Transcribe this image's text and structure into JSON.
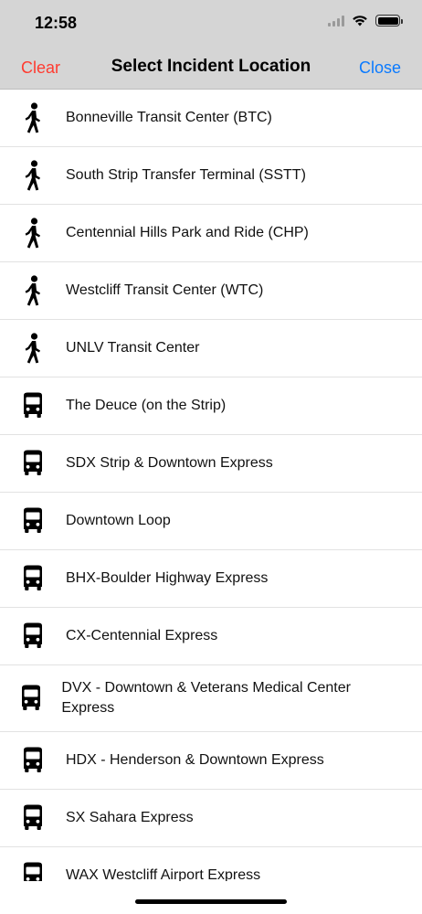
{
  "status_bar": {
    "time": "12:58"
  },
  "nav": {
    "clear_label": "Clear",
    "title": "Select Incident Location",
    "close_label": "Close"
  },
  "colors": {
    "clear": "#ff3b30",
    "close": "#0a7aff",
    "header_bg": "#d5d5d5"
  },
  "locations": [
    {
      "icon": "walking-person-icon",
      "label": "Bonneville Transit Center (BTC)"
    },
    {
      "icon": "walking-person-icon",
      "label": "South Strip Transfer Terminal (SSTT)"
    },
    {
      "icon": "walking-person-icon",
      "label": "Centennial Hills Park and Ride (CHP)"
    },
    {
      "icon": "walking-person-icon",
      "label": "Westcliff Transit Center (WTC)"
    },
    {
      "icon": "walking-person-icon",
      "label": "UNLV Transit Center"
    },
    {
      "icon": "bus-icon",
      "label": "The Deuce (on the Strip)"
    },
    {
      "icon": "bus-icon",
      "label": "SDX Strip & Downtown Express"
    },
    {
      "icon": "bus-icon",
      "label": "Downtown Loop"
    },
    {
      "icon": "bus-icon",
      "label": "BHX-Boulder Highway Express"
    },
    {
      "icon": "bus-icon",
      "label": "CX-Centennial Express"
    },
    {
      "icon": "bus-icon",
      "label": "DVX - Downtown & Veterans Medical Center Express"
    },
    {
      "icon": "bus-icon",
      "label": "HDX - Henderson & Downtown Express"
    },
    {
      "icon": "bus-icon",
      "label": "SX Sahara Express"
    },
    {
      "icon": "bus-icon",
      "label": "WAX Westcliff Airport Express"
    }
  ]
}
